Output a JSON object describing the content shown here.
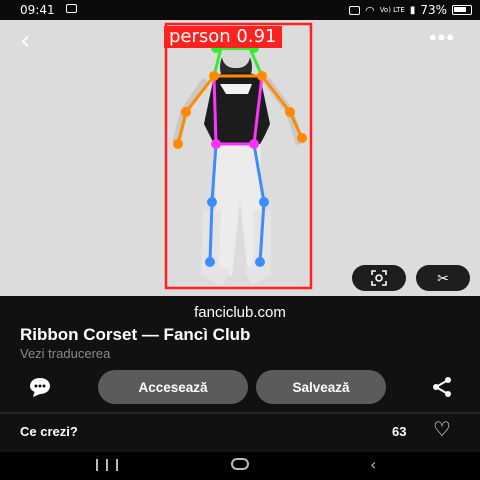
{
  "status_bar": {
    "time": "09:41",
    "battery": "73%",
    "network": "Vo) LTE",
    "icons": [
      "image-icon",
      "alarm-icon",
      "wifi-icon",
      "signal-icon",
      "battery-icon"
    ]
  },
  "detection": {
    "label": "person 0.91",
    "box_color": "#ff2020"
  },
  "pin": {
    "domain": "fanciclub.com",
    "title": "Ribbon Corset — Fancì Club",
    "translate": "Vezi traducerea"
  },
  "actions": {
    "visit": "Accesează",
    "save": "Salvează"
  },
  "comments": {
    "prompt": "Ce crezi?",
    "count": "63"
  },
  "colors": {
    "background": "#111111",
    "button_bg": "#5b5b5b",
    "keypoint_green": "#33ee33",
    "limb_orange": "#ff8a00",
    "torso_magenta": "#ff33ff",
    "leg_blue": "#3c8cff"
  }
}
